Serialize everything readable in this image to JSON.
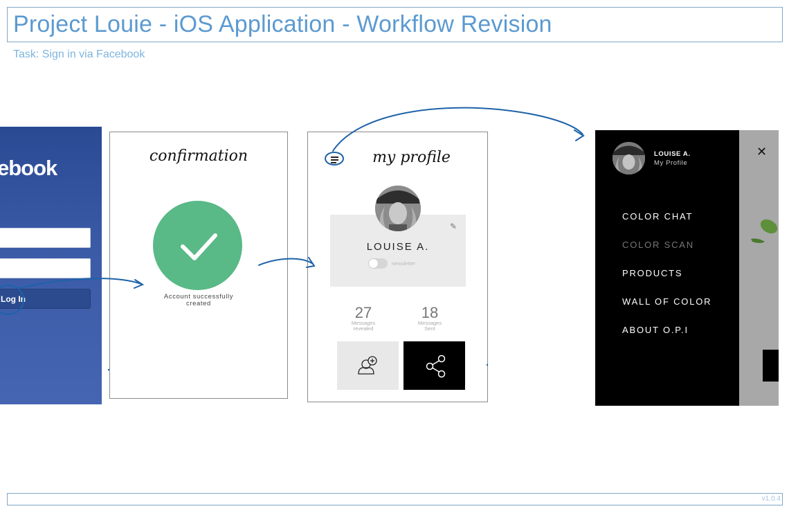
{
  "header": {
    "title": "Project Louie - iOS Application - Workflow Revision",
    "task": "Task: Sign in via Facebook"
  },
  "footer": {
    "version": "v1.0.4"
  },
  "facebook": {
    "logo": "facebook",
    "login_label": "Log In"
  },
  "confirmation": {
    "title": "confirmation",
    "message_line1": "Account successfully",
    "message_line2": "created"
  },
  "profile": {
    "title": "my profile",
    "name": "LOUISE A.",
    "toggle_label": "newsletter",
    "stats": [
      {
        "value": "27",
        "label_line1": "Messages",
        "label_line2": "revealed"
      },
      {
        "value": "18",
        "label_line1": "Messages",
        "label_line2": "Sent"
      }
    ],
    "icons": {
      "menu": "hamburger-menu-icon",
      "edit": "edit-pencil-icon",
      "add_user": "add-user-icon",
      "share": "share-icon"
    }
  },
  "side_menu": {
    "user_name": "LOUISE A.",
    "user_sub": "My Profile",
    "items": [
      {
        "label": "COLOR CHAT",
        "active": true
      },
      {
        "label": "COLOR SCAN",
        "active": false
      },
      {
        "label": "PRODUCTS",
        "active": true
      },
      {
        "label": "WALL OF COLOR",
        "active": true
      },
      {
        "label": "ABOUT O.P.I",
        "active": true
      }
    ],
    "close_icon": "close-icon"
  },
  "colors": {
    "annotation_blue": "#1e62a8",
    "title_blue": "#5c9ad0",
    "facebook_blue": "#3b5ba7",
    "check_green": "#59b987",
    "drawer_black": "#000000"
  }
}
